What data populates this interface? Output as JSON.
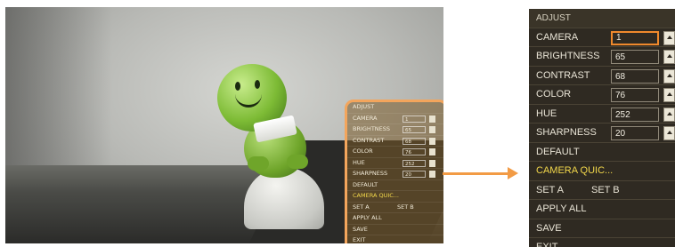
{
  "osd": {
    "title": "ADJUST",
    "fields": [
      {
        "label": "CAMERA",
        "value": "1"
      },
      {
        "label": "BRIGHTNESS",
        "value": "65"
      },
      {
        "label": "CONTRAST",
        "value": "68"
      },
      {
        "label": "COLOR",
        "value": "76"
      },
      {
        "label": "HUE",
        "value": "252"
      },
      {
        "label": "SHARPNESS",
        "value": "20"
      }
    ],
    "default_label": "DEFAULT",
    "camera_quick_label": "CAMERA QUIC...",
    "set_a_label": "SET A",
    "set_b_label": "SET B",
    "apply_all_label": "APPLY ALL",
    "save_label": "SAVE",
    "exit_label": "EXIT"
  },
  "colors": {
    "highlight_outline": "#f3a55c",
    "arrow": "#f29b45",
    "quick_text": "#f3d84b",
    "osd_background": "#2f2a22"
  }
}
